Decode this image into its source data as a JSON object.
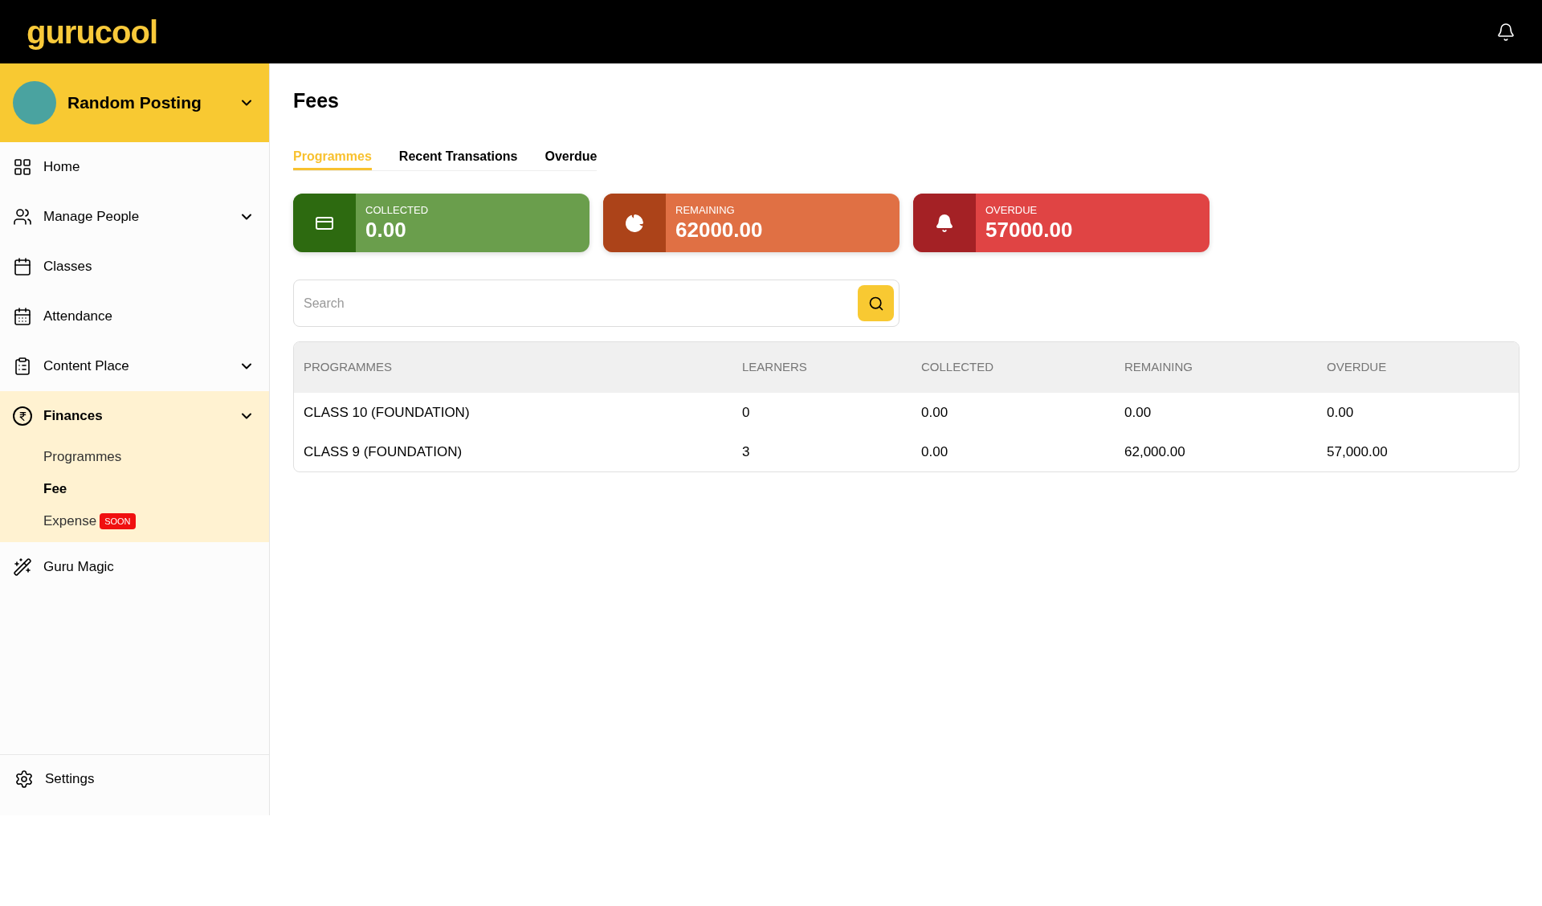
{
  "header": {
    "logo": "gurucool"
  },
  "sidebar": {
    "org": {
      "name": "Random Posting"
    },
    "items": [
      {
        "label": "Home",
        "kind": "link",
        "selected": false
      },
      {
        "label": "Manage People",
        "kind": "group",
        "selected": false
      },
      {
        "label": "Classes",
        "kind": "link",
        "selected": false
      },
      {
        "label": "Attendance",
        "kind": "link",
        "selected": false
      },
      {
        "label": "Content Place",
        "kind": "group",
        "selected": false
      },
      {
        "label": "Finances",
        "kind": "group",
        "selected": true,
        "children": [
          {
            "label": "Programmes",
            "selected": false
          },
          {
            "label": "Fee",
            "selected": true
          },
          {
            "label": "Expense",
            "selected": false,
            "badge": "SOON"
          }
        ]
      },
      {
        "label": "Guru Magic",
        "kind": "link",
        "selected": false
      }
    ],
    "footer": {
      "label": "Settings"
    }
  },
  "page": {
    "title": "Fees",
    "tabs": [
      {
        "label": "Programmes",
        "selected": true
      },
      {
        "label": "Recent Transations",
        "selected": false
      },
      {
        "label": "Overdue",
        "selected": false
      }
    ],
    "cards": [
      {
        "kind": "collected",
        "label": "COLLECTED",
        "value": "0.00"
      },
      {
        "kind": "remaining",
        "label": "REMAINING",
        "value": "62000.00"
      },
      {
        "kind": "overdue",
        "label": "OVERDUE",
        "value": "57000.00"
      }
    ],
    "search": {
      "placeholder": "Search"
    },
    "table": {
      "columns": [
        "PROGRAMMES",
        "LEARNERS",
        "COLLECTED",
        "REMAINING",
        "OVERDUE"
      ],
      "rows": [
        [
          "CLASS 10 (FOUNDATION)",
          "0",
          "0.00",
          "0.00",
          "0.00"
        ],
        [
          "CLASS 9 (FOUNDATION)",
          "3",
          "0.00",
          "62,000.00",
          "57,000.00"
        ]
      ]
    }
  }
}
